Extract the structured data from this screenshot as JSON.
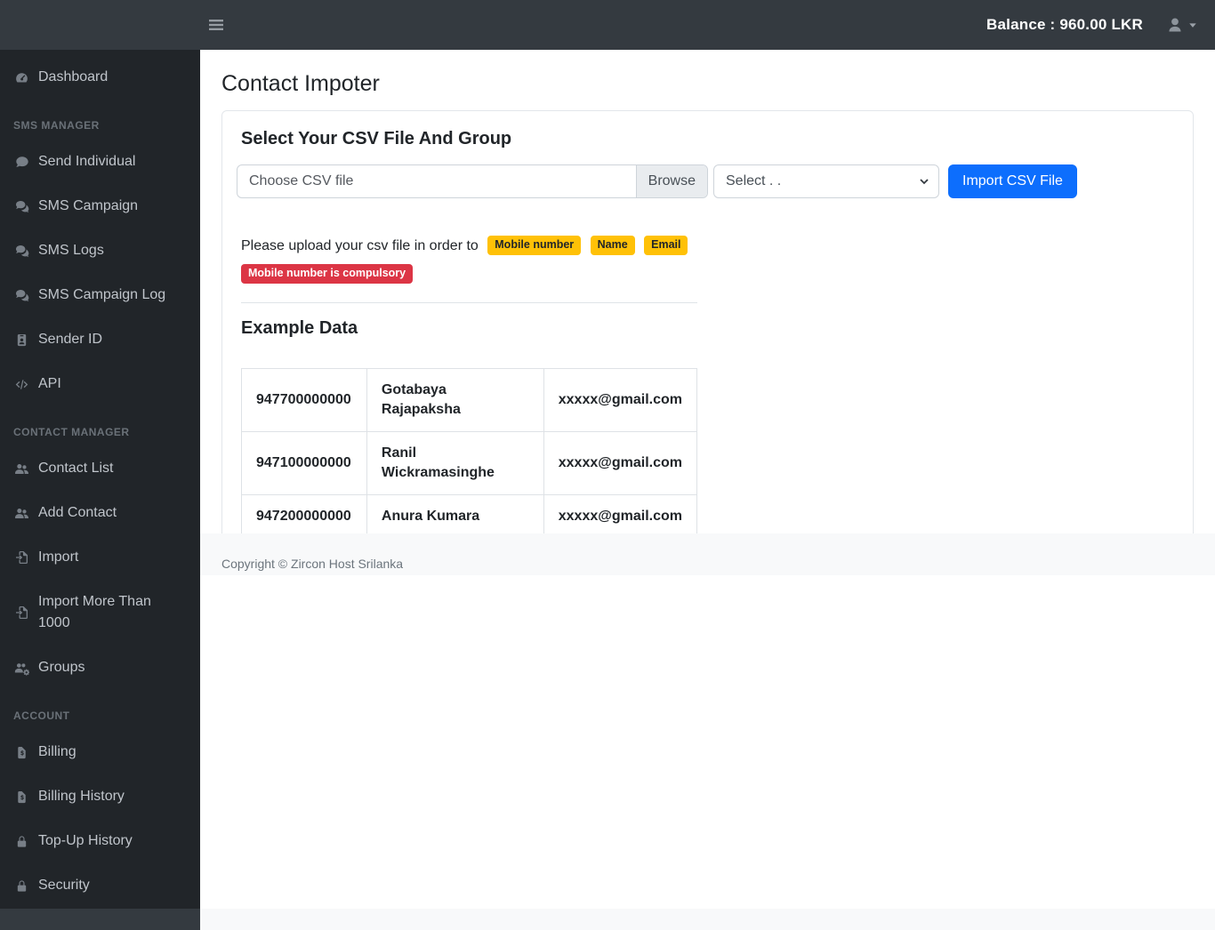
{
  "topbar": {
    "balance": "Balance : 960.00 LKR"
  },
  "sidebar": {
    "sections": [
      {
        "heading": "",
        "items": [
          {
            "label": "Dashboard",
            "icon": "tachometer-icon"
          }
        ]
      },
      {
        "heading": "SMS MANAGER",
        "items": [
          {
            "label": "Send Individual",
            "icon": "comment-icon"
          },
          {
            "label": "SMS Campaign",
            "icon": "comments-icon"
          },
          {
            "label": "SMS Logs",
            "icon": "comments-icon"
          },
          {
            "label": "SMS Campaign Log",
            "icon": "comments-icon"
          },
          {
            "label": "Sender ID",
            "icon": "id-badge-icon"
          },
          {
            "label": "API",
            "icon": "code-icon"
          }
        ]
      },
      {
        "heading": "CONTACT MANAGER",
        "items": [
          {
            "label": "Contact List",
            "icon": "users-icon"
          },
          {
            "label": "Add Contact",
            "icon": "users-icon"
          },
          {
            "label": "Import",
            "icon": "file-import-icon"
          },
          {
            "label": "Import More Than 1000",
            "icon": "file-import-icon"
          },
          {
            "label": "Groups",
            "icon": "users-gear-icon"
          }
        ]
      },
      {
        "heading": "ACCOUNT",
        "items": [
          {
            "label": "Billing",
            "icon": "file-invoice-dollar-icon"
          },
          {
            "label": "Billing History",
            "icon": "file-invoice-dollar-icon"
          },
          {
            "label": "Top-Up History",
            "icon": "lock-icon"
          },
          {
            "label": "Security",
            "icon": "lock-icon"
          }
        ]
      }
    ]
  },
  "main": {
    "page_title": "Contact Impoter",
    "card": {
      "title": "Select Your CSV File And Group",
      "file_input": {
        "placeholder": "Choose CSV file",
        "browse_label": "Browse"
      },
      "group_select": {
        "value": "Select . ."
      },
      "import_button_label": "Import CSV File",
      "note_text": "Please upload your csv file in order to",
      "badges": [
        "Mobile number",
        "Name",
        "Email"
      ],
      "warning_badge": "Mobile number is compulsory",
      "example": {
        "title": "Example Data",
        "rows": [
          [
            "947700000000",
            "Gotabaya Rajapaksha",
            "xxxxx@gmail.com"
          ],
          [
            "947100000000",
            "Ranil Wickramasinghe",
            "xxxxx@gmail.com"
          ],
          [
            "947200000000",
            "Anura Kumara",
            "xxxxx@gmail.com"
          ]
        ]
      }
    }
  },
  "footer": {
    "copyright": "Copyright © Zircon Host Srilanka"
  },
  "colors": {
    "navbar_bg": "#343a40",
    "sidebar_bg": "#212529",
    "primary": "#0d6efd",
    "warning": "#ffc107",
    "danger": "#dc3545",
    "footer_bg": "#f8f9fa"
  }
}
